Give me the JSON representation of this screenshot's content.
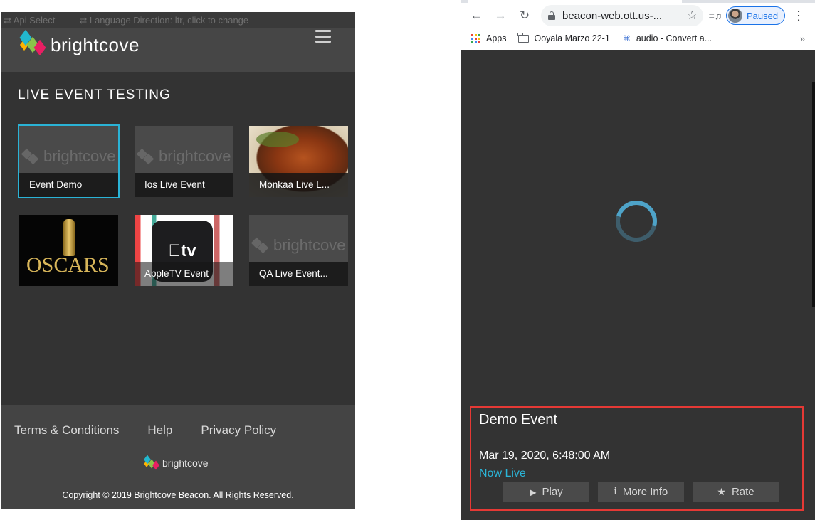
{
  "left_app": {
    "dev_bar": {
      "api_select": "⇄ Api Select",
      "language_direction": "⇄ Language Direction: ltr, click to change"
    },
    "brand": "brightcove",
    "section_title": "LIVE EVENT TESTING",
    "placeholder_text": "brightcove",
    "tiles": [
      {
        "label": "Event Demo",
        "thumb": "placeholder",
        "active": true
      },
      {
        "label": "Ios Live Event",
        "thumb": "placeholder",
        "active": false
      },
      {
        "label": "Monkaa Live L...",
        "thumb": "turkey",
        "active": false
      },
      {
        "label": "",
        "thumb": "oscars",
        "thumb_text": "OSCARS",
        "active": false
      },
      {
        "label": "AppleTV Event",
        "thumb": "appletv",
        "thumb_text": "tv",
        "active": false
      },
      {
        "label": "QA Live Event...",
        "thumb": "placeholder",
        "active": false
      }
    ],
    "footer": {
      "links": [
        "Terms & Conditions",
        "Help",
        "Privacy Policy"
      ],
      "brand": "brightcove",
      "copyright": "Copyright © 2019 Brightcove Beacon. All Rights Reserved."
    }
  },
  "browser": {
    "url": "beacon-web.ott.us-...",
    "profile_status": "Paused",
    "bookmarks": {
      "apps": "Apps",
      "folder": "Ooyala Marzo 22-1",
      "audio": "audio - Convert a...",
      "more": "»"
    },
    "icons": [
      "back-arrow-icon",
      "forward-arrow-icon",
      "reload-icon",
      "lock-icon",
      "star-icon",
      "media-control-icon",
      "kebab-menu-icon"
    ]
  },
  "event": {
    "title": "Demo Event",
    "date": "Mar 19, 2020, 6:48:00 AM",
    "status": "Now Live",
    "buttons": {
      "play": "Play",
      "more_info": "More Info",
      "rate": "Rate"
    }
  },
  "colors": {
    "accent": "#2ab3d6",
    "highlight_border": "#e53935",
    "panel_bg": "#333333",
    "profile_blue": "#1a73e8"
  }
}
